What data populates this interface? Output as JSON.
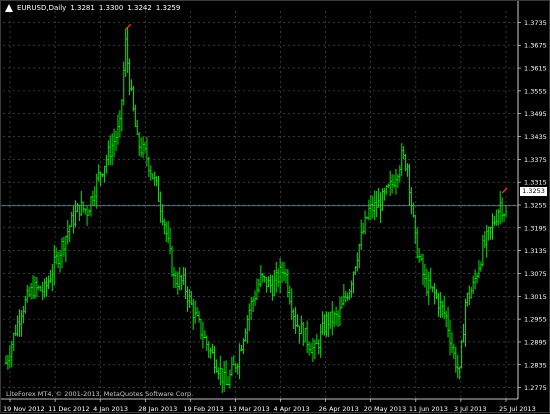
{
  "header": {
    "symbol_timeframe": "EURUSD,Daily",
    "open": "1.3281",
    "high": "1.3300",
    "low": "1.3242",
    "close": "1.3259",
    "icon": "chart-properties-icon"
  },
  "footer": {
    "copyright": "LiteForex MT4, © 2001-2013, MetaQuotes Software Corp."
  },
  "current_price_label": "1.3253",
  "colors": {
    "background": "#000000",
    "candle": "#00e600",
    "grid": "#5a5a5a",
    "axis_text": "#ffffff",
    "current_price_line": "#7a8fa0",
    "fractal_arrow": "#ff3030"
  },
  "chart_data": {
    "type": "candlestick",
    "title": "EURUSD,Daily",
    "price_axis_labels": [
      "1.3735",
      "1.3675",
      "1.3615",
      "1.3555",
      "1.3495",
      "1.3435",
      "1.3375",
      "1.3315",
      "1.3255",
      "1.3195",
      "1.3135",
      "1.3075",
      "1.3015",
      "1.2955",
      "1.2895",
      "1.2835",
      "1.2775"
    ],
    "time_axis_labels": [
      "19 Nov 2012",
      "11 Dec 2012",
      "4 Jan 2013",
      "28 Jan 2013",
      "19 Feb 2013",
      "13 Mar 2013",
      "4 Apr 2013",
      "26 Apr 2013",
      "20 May 2013",
      "11 Jun 2013",
      "3 Jul 2013",
      "25 Jul 2013"
    ],
    "ylim": [
      1.2745,
      1.3765
    ],
    "current_price": 1.3253,
    "grid": true,
    "keypoints": [
      [
        0,
        1.284
      ],
      [
        8,
        1.298
      ],
      [
        14,
        1.3035
      ],
      [
        20,
        1.303
      ],
      [
        26,
        1.311
      ],
      [
        33,
        1.32
      ],
      [
        38,
        1.325
      ],
      [
        42,
        1.324
      ],
      [
        48,
        1.333
      ],
      [
        54,
        1.34
      ],
      [
        59,
        1.346
      ],
      [
        62,
        1.368
      ],
      [
        64,
        1.358
      ],
      [
        68,
        1.342
      ],
      [
        73,
        1.338
      ],
      [
        78,
        1.33
      ],
      [
        82,
        1.321
      ],
      [
        87,
        1.306
      ],
      [
        92,
        1.305
      ],
      [
        98,
        1.296
      ],
      [
        104,
        1.289
      ],
      [
        110,
        1.283
      ],
      [
        114,
        1.278
      ],
      [
        120,
        1.285
      ],
      [
        126,
        1.298
      ],
      [
        132,
        1.306
      ],
      [
        138,
        1.304
      ],
      [
        144,
        1.309
      ],
      [
        150,
        1.295
      ],
      [
        156,
        1.29
      ],
      [
        160,
        1.287
      ],
      [
        166,
        1.295
      ],
      [
        172,
        1.296
      ],
      [
        178,
        1.304
      ],
      [
        183,
        1.315
      ],
      [
        188,
        1.324
      ],
      [
        194,
        1.326
      ],
      [
        200,
        1.331
      ],
      [
        205,
        1.338
      ],
      [
        208,
        1.336
      ],
      [
        212,
        1.316
      ],
      [
        217,
        1.305
      ],
      [
        222,
        1.302
      ],
      [
        228,
        1.296
      ],
      [
        232,
        1.286
      ],
      [
        235,
        1.281
      ],
      [
        238,
        1.3
      ],
      [
        242,
        1.304
      ],
      [
        247,
        1.314
      ],
      [
        252,
        1.32
      ],
      [
        256,
        1.326
      ],
      [
        259,
        1.323
      ]
    ],
    "bar_count": 260,
    "fractal_marks": [
      62,
      257
    ]
  }
}
